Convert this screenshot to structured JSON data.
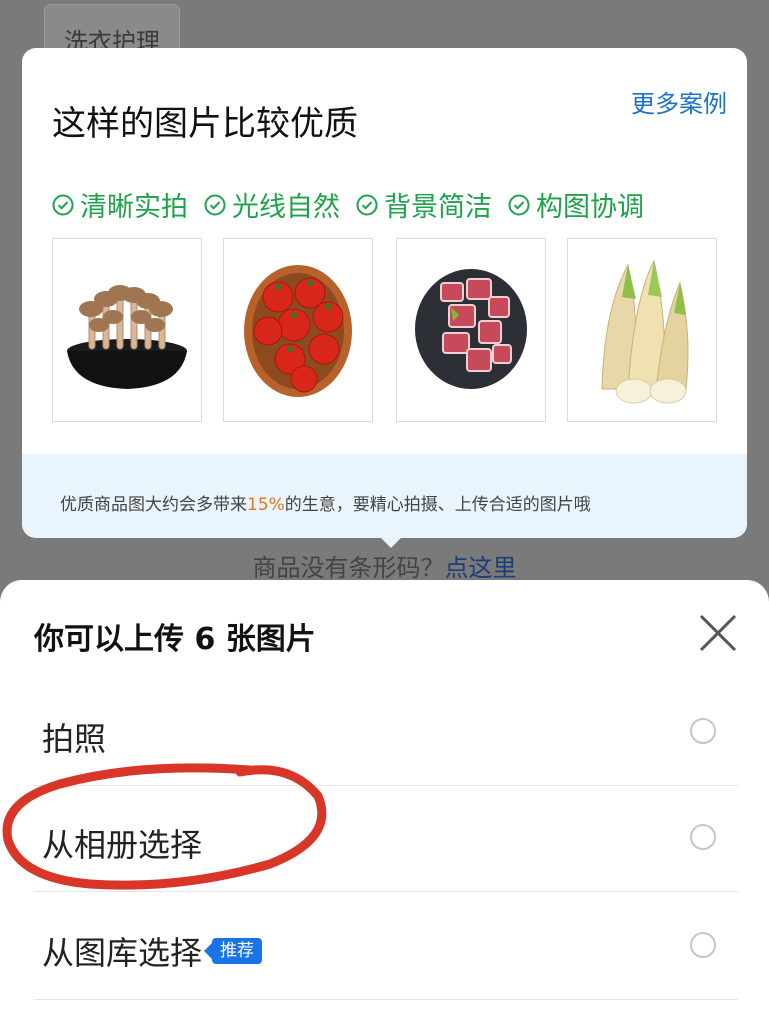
{
  "background": {
    "tab_label": "洗衣护理",
    "barcode_text": "商品没有条形码？",
    "barcode_link": "点这里"
  },
  "tip_card": {
    "title": "这样的图片比较优质",
    "more_link": "更多案例",
    "checks": [
      "清晰实拍",
      "光线自然",
      "背景简洁",
      "构图协调"
    ],
    "examples": [
      {
        "icon": "mushroom-bowl-image"
      },
      {
        "icon": "tomato-bowl-image"
      },
      {
        "icon": "pork-ribs-plate-image"
      },
      {
        "icon": "bamboo-shoots-image"
      }
    ],
    "hint_prefix": "优质商品图大约会多带来",
    "hint_percent": "15%",
    "hint_suffix": "的生意，要精心拍摄、上传合适的图片哦"
  },
  "sheet": {
    "title": "你可以上传 6 张图片",
    "options": [
      {
        "label": "拍照"
      },
      {
        "label": "从相册选择"
      },
      {
        "label": "从图库选择",
        "badge": "推荐"
      }
    ]
  },
  "colors": {
    "accent_green": "#1fa34a",
    "link_blue": "#1a73c8",
    "badge_blue": "#1a73e8",
    "highlight_orange": "#e8741d",
    "annotation_red": "#d9362a"
  }
}
